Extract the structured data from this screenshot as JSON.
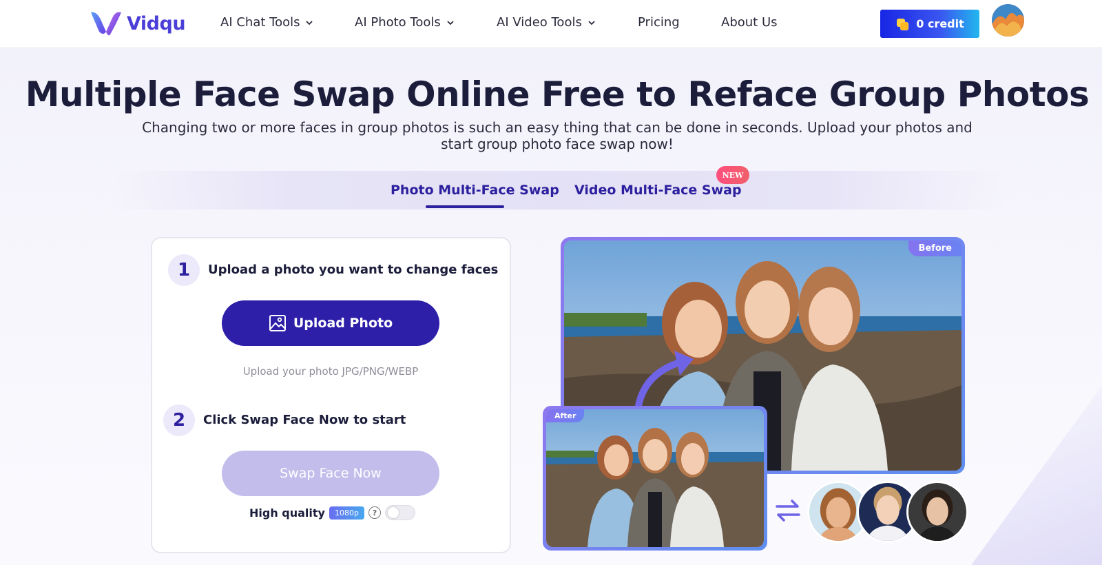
{
  "brand": {
    "name": "Vidqu",
    "accent": "#4b3fd8"
  },
  "nav": {
    "items": [
      {
        "label": "AI Chat Tools",
        "dropdown": true
      },
      {
        "label": "AI Photo Tools",
        "dropdown": true
      },
      {
        "label": "AI Video Tools",
        "dropdown": true
      },
      {
        "label": "Pricing",
        "dropdown": false
      },
      {
        "label": "About Us",
        "dropdown": false
      }
    ],
    "credit_label": "0 credit"
  },
  "hero": {
    "title": "Multiple Face Swap Online Free to Reface Group Photos",
    "subtitle": "Changing two or more faces in group photos is such an easy thing that can be done in seconds. Upload your photos and start group photo face swap now!"
  },
  "tabs": [
    {
      "label": "Photo Multi-Face Swap",
      "active": true
    },
    {
      "label": "Video Multi-Face Swap",
      "active": false,
      "badge": "NEW"
    }
  ],
  "steps": [
    {
      "number": "1",
      "text": "Upload a photo you want to change faces"
    },
    {
      "number": "2",
      "text": "Click Swap Face Now to start"
    }
  ],
  "upload": {
    "button_label": "Upload Photo",
    "hint": "Upload your photo JPG/PNG/WEBP"
  },
  "swap": {
    "button_label": "Swap Face Now",
    "enabled": false
  },
  "quality": {
    "label": "High quality",
    "badge": "1080p",
    "help_icon": "question-circle-icon",
    "toggle_on": false
  },
  "preview": {
    "before_label": "Before",
    "after_label": "After"
  },
  "colors": {
    "primary": "#2d1fa8",
    "primary_disabled": "#c3bdec",
    "heading": "#1b1d3a",
    "new_badge": "#ff4f7d"
  }
}
